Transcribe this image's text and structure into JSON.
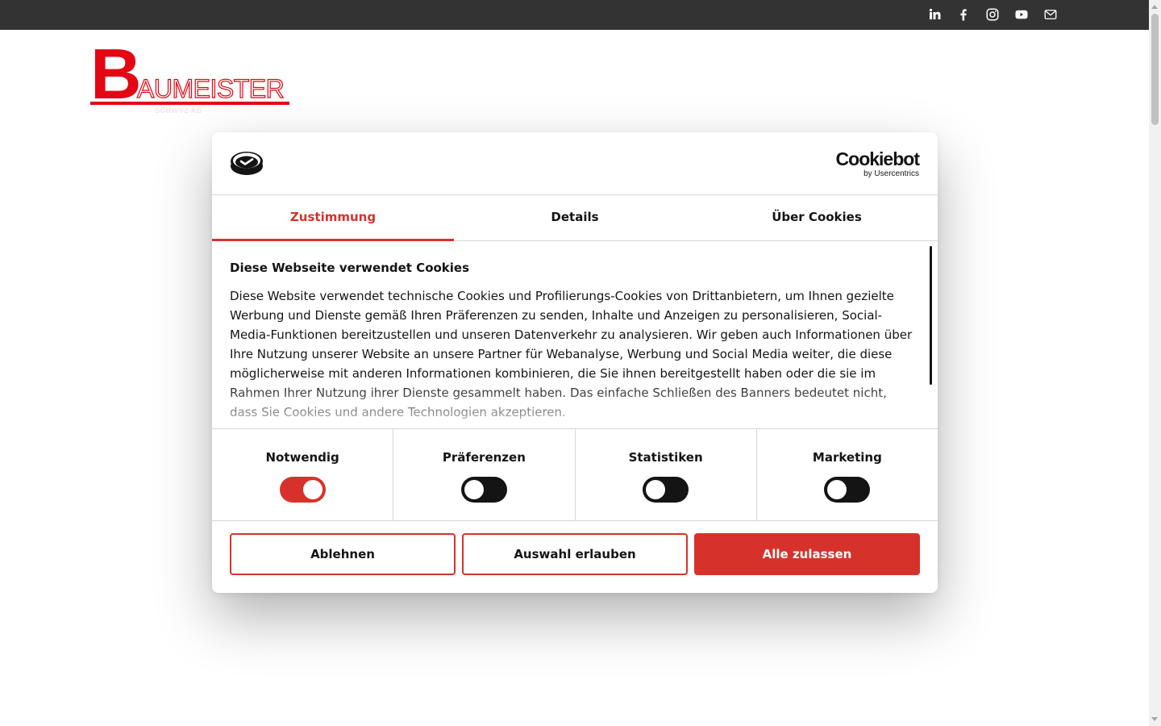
{
  "topbar": {
    "social_icons": [
      "linkedin-icon",
      "facebook-icon",
      "instagram-icon",
      "youtube-icon",
      "mail-icon"
    ]
  },
  "logo": {
    "initial": "B",
    "rest": "AUMEISTER",
    "subtitle": "SCHWYZ AG",
    "color": "#e30613"
  },
  "dialog": {
    "brand_name": "Cookiebot",
    "brand_by": "by Usercentrics",
    "tabs": [
      {
        "label": "Zustimmung",
        "active": true
      },
      {
        "label": "Details",
        "active": false
      },
      {
        "label": "Über Cookies",
        "active": false
      }
    ],
    "heading": "Diese Webseite verwendet Cookies",
    "body": "Diese Website verwendet technische Cookies und Profilierungs-Cookies von Drittanbietern, um Ihnen gezielte Werbung und Dienste gemäß Ihren Präferenzen zu senden, Inhalte und Anzeigen zu personalisieren, Social-Media-Funktionen bereitzustellen und unseren Datenverkehr zu analysieren. Wir geben auch Informationen über Ihre Nutzung unserer Website an unsere Partner für Webanalyse, Werbung und Social Media weiter, die diese möglicherweise mit anderen Informationen kombinieren, die Sie ihnen bereitgestellt haben oder die sie im Rahmen Ihrer Nutzung ihrer Dienste gesammelt haben. Das einfache Schließen des Banners bedeutet nicht, dass Sie Cookies und andere Technologien akzeptieren.",
    "toggles": [
      {
        "label": "Notwendig",
        "on": true
      },
      {
        "label": "Präferenzen",
        "on": false
      },
      {
        "label": "Statistiken",
        "on": false
      },
      {
        "label": "Marketing",
        "on": false
      }
    ],
    "buttons": {
      "decline": "Ablehnen",
      "allow_selection": "Auswahl erlauben",
      "allow_all": "Alle zulassen"
    },
    "accent_color": "#d6322b"
  }
}
